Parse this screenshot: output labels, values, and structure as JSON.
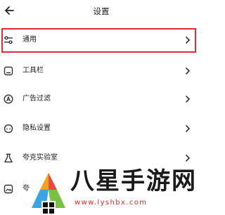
{
  "header": {
    "title": "设置",
    "back_icon": "back-arrow-icon"
  },
  "rows": [
    {
      "label": "通用",
      "icon": "sliders-icon"
    },
    {
      "label": "工具栏",
      "icon": "toolbar-icon"
    },
    {
      "label": "广告过滤",
      "icon": "ad-filter-icon"
    },
    {
      "label": "隐私设置",
      "icon": "privacy-icon"
    },
    {
      "label": "夸克实验室",
      "icon": "flask-icon"
    },
    {
      "label": "夸",
      "icon": "image-icon"
    }
  ],
  "highlight_color": "#e02b2f",
  "watermark": {
    "text": "八星手游网",
    "url": "www.lyshbx.com"
  }
}
